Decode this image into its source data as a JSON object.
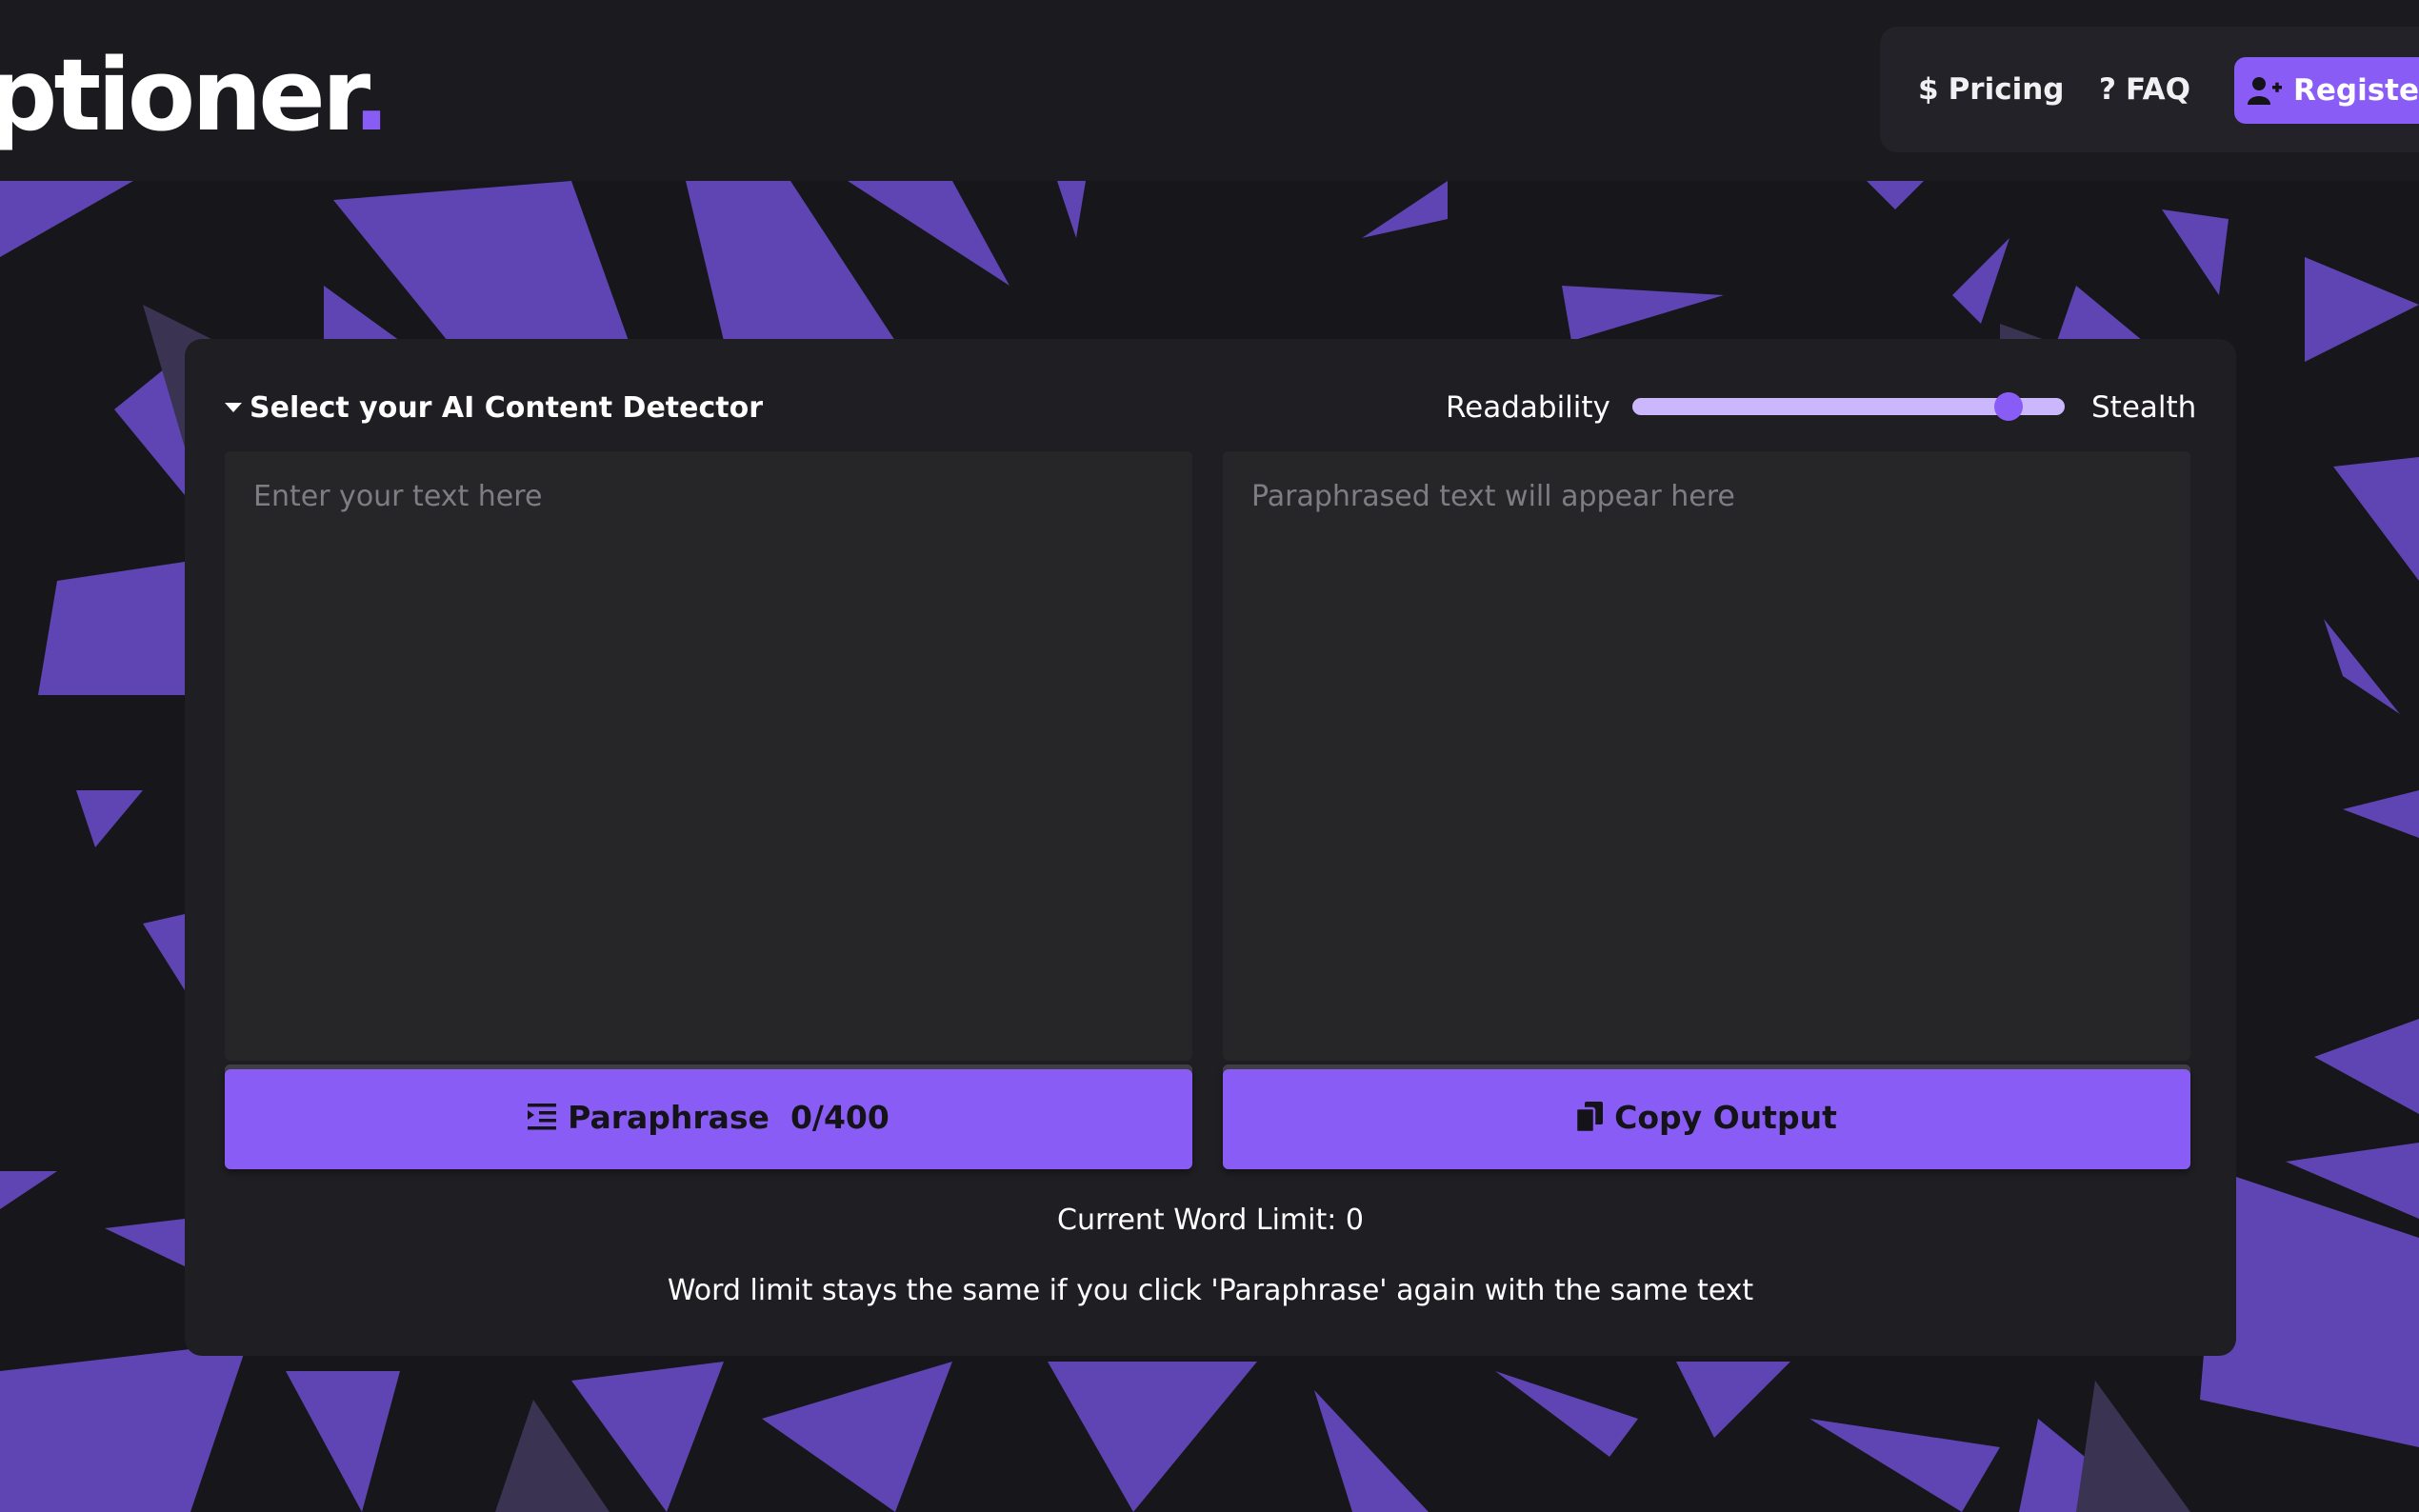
{
  "brand": {
    "logo_text": "ptioner",
    "logo_dot": "."
  },
  "nav": {
    "pricing_icon": "$",
    "pricing_label": "Pricing",
    "faq_icon": "?",
    "faq_label": "FAQ",
    "register_label": "Register"
  },
  "editor": {
    "detector_label": "Select your AI Content Detector",
    "slider_left_label": "Readability",
    "slider_right_label": "Stealth",
    "slider_value_percent": 87,
    "input_placeholder": "Enter your text here",
    "output_placeholder": "Paraphrased text will appear here",
    "paraphrase_label": "Paraphrase",
    "word_count": "0/400",
    "copy_label": "Copy Output",
    "word_limit_text": "Current Word Limit: 0",
    "note_text": "Word limit stays the same if you click 'Paraphrase' again with the same text"
  },
  "colors": {
    "accent": "#8a5cf6",
    "background": "#17161b",
    "panel": "#1f1e23",
    "textbox": "#262528"
  }
}
